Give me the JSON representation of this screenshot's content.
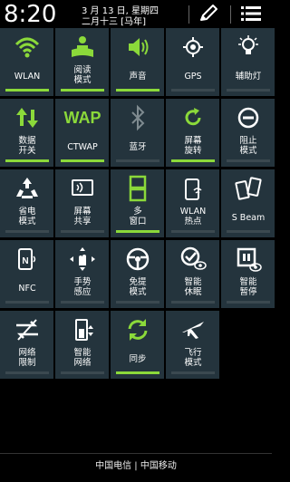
{
  "header": {
    "time": "8:20",
    "date_line": "3 月 13 日, 星期四",
    "lunar_line": "二月十三 [马年]",
    "edit_icon": "pencil-icon",
    "menu_icon": "list-menu-icon"
  },
  "tiles": [
    {
      "label": "WLAN",
      "icon": "wifi-icon",
      "on": true
    },
    {
      "label": "阅读\n模式",
      "icon": "reading-mode-icon",
      "on": true
    },
    {
      "label": "声音",
      "icon": "speaker-icon",
      "on": true
    },
    {
      "label": "GPS",
      "icon": "gps-icon",
      "on": false
    },
    {
      "label": "辅助灯",
      "icon": "flashlight-icon",
      "on": false
    },
    {
      "label": "数据\n开关",
      "icon": "mobile-data-icon",
      "on": true
    },
    {
      "label": "CTWAP",
      "icon": "wap-icon",
      "on": true
    },
    {
      "label": "蓝牙",
      "icon": "bluetooth-icon",
      "on": false
    },
    {
      "label": "屏幕\n旋转",
      "icon": "rotate-icon",
      "on": true
    },
    {
      "label": "阻止\n模式",
      "icon": "block-icon",
      "on": false
    },
    {
      "label": "省电\n模式",
      "icon": "power-saving-icon",
      "on": false
    },
    {
      "label": "屏幕\n共享",
      "icon": "screen-share-icon",
      "on": false
    },
    {
      "label": "多\n窗口",
      "icon": "multi-window-icon",
      "on": true
    },
    {
      "label": "WLAN\n热点",
      "icon": "hotspot-icon",
      "on": false
    },
    {
      "label": "S Beam",
      "icon": "s-beam-icon",
      "on": false
    },
    {
      "label": "NFC",
      "icon": "nfc-icon",
      "on": false
    },
    {
      "label": "手势\n感应",
      "icon": "gesture-icon",
      "on": false
    },
    {
      "label": "免提\n模式",
      "icon": "driving-mode-icon",
      "on": false
    },
    {
      "label": "智能\n休眠",
      "icon": "smart-stay-icon",
      "on": false
    },
    {
      "label": "智能\n暂停",
      "icon": "smart-pause-icon",
      "on": false
    },
    {
      "label": "网络\n限制",
      "icon": "network-limit-icon",
      "on": false
    },
    {
      "label": "智能\n网络",
      "icon": "smart-network-icon",
      "on": false
    },
    {
      "label": "同步",
      "icon": "sync-icon",
      "on": true
    },
    {
      "label": "飞行\n模式",
      "icon": "airplane-icon",
      "on": false
    }
  ],
  "footer": {
    "carriers": "中国电信 | 中国移动"
  },
  "colors": {
    "tile_bg": "#24343d",
    "accent": "#8bd93a",
    "bar_off": "#3b4950"
  }
}
